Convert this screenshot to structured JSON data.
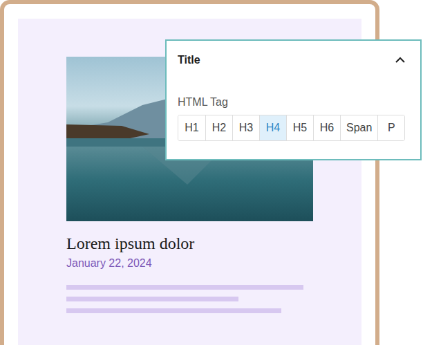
{
  "panel": {
    "title": "Title",
    "expanded": true,
    "field_label": "HTML Tag",
    "options": [
      {
        "label": "H1",
        "selected": false
      },
      {
        "label": "H2",
        "selected": false
      },
      {
        "label": "H3",
        "selected": false
      },
      {
        "label": "H4",
        "selected": true
      },
      {
        "label": "H5",
        "selected": false
      },
      {
        "label": "H6",
        "selected": false
      },
      {
        "label": "Span",
        "selected": false
      },
      {
        "label": "P",
        "selected": false
      }
    ]
  },
  "post": {
    "title": "Lorem ipsum dolor",
    "date": "January 22, 2024"
  }
}
